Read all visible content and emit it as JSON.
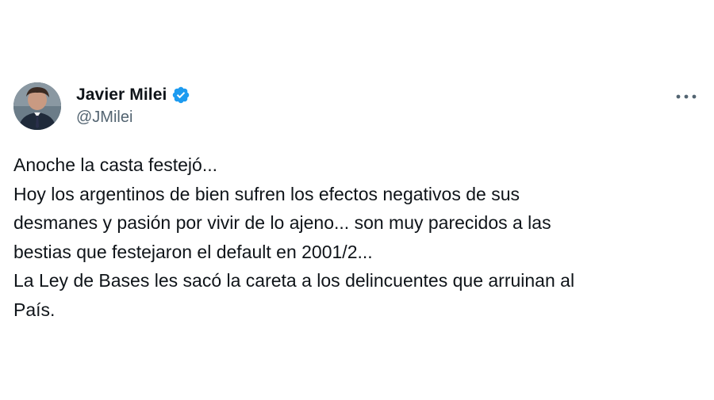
{
  "author": {
    "display_name": "Javier Milei",
    "handle": "@JMilei",
    "verified": true,
    "verified_color": "#1d9bf0"
  },
  "tweet": {
    "lines": [
      "Anoche la casta festejó...",
      "Hoy los argentinos de bien sufren los efectos negativos de sus",
      "desmanes y pasión por vivir de lo ajeno... son muy parecidos a las",
      "bestias que festejaron el default en 2001/2...",
      "La Ley de Bases les sacó la careta a los delincuentes que arruinan al",
      "País."
    ]
  },
  "icons": {
    "verified": "verified-badge-icon",
    "more": "more-options-icon"
  }
}
